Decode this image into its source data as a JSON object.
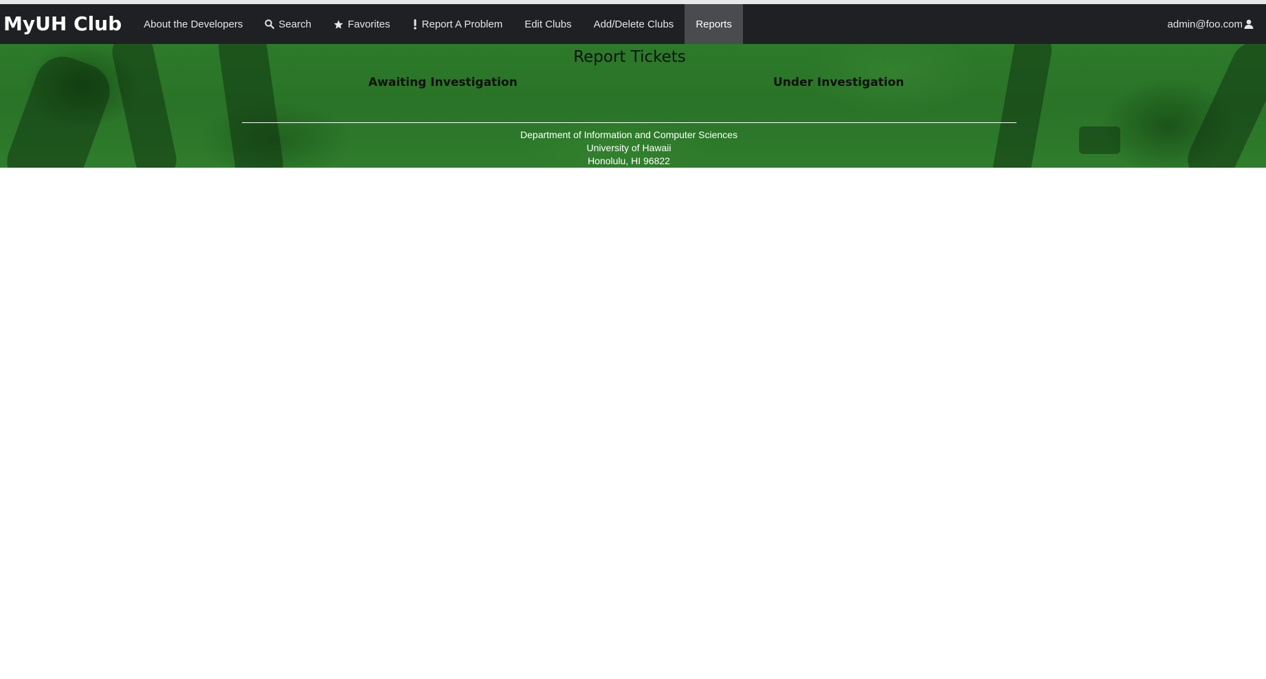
{
  "navbar": {
    "brand": "MyUH Club",
    "items": [
      {
        "label": "About the Developers",
        "icon": ""
      },
      {
        "label": "Search",
        "icon": "search-icon"
      },
      {
        "label": "Favorites",
        "icon": "star-icon"
      },
      {
        "label": "Report A Problem",
        "icon": "exclamation-icon"
      },
      {
        "label": "Edit Clubs",
        "icon": ""
      },
      {
        "label": "Add/Delete Clubs",
        "icon": ""
      },
      {
        "label": "Reports",
        "icon": "",
        "active": true
      }
    ],
    "user": "admin@foo.com",
    "user_icon": "user-icon"
  },
  "main": {
    "title": "Report Tickets",
    "columns": [
      {
        "heading": "Awaiting Investigation"
      },
      {
        "heading": "Under Investigation"
      }
    ]
  },
  "footer": {
    "lines": [
      "Department of Information and Computer Sciences",
      "University of Hawaii",
      "Honolulu, HI 96822"
    ]
  },
  "colors": {
    "navbar_bg": "#1f2023",
    "active_tab_bg": "#4a4b4e",
    "hero_green": "#2c7a2a"
  }
}
